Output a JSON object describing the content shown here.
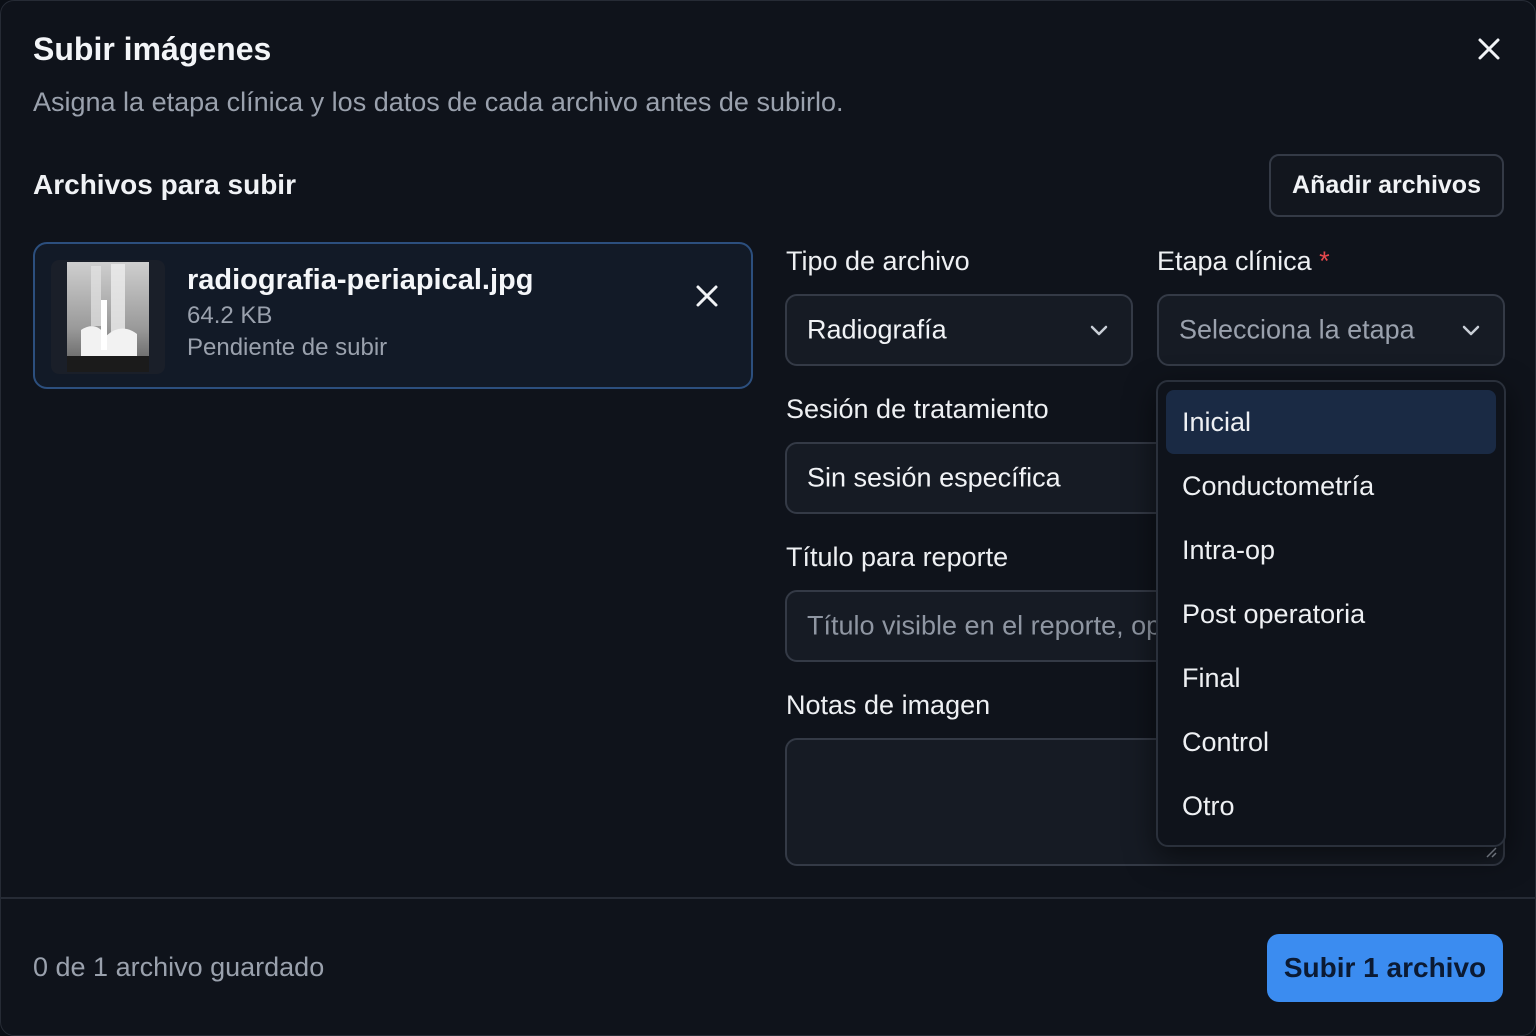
{
  "dialog": {
    "title": "Subir imágenes",
    "subtitle": "Asigna la etapa clínica y los datos de cada archivo antes de subirlo.",
    "close_icon": "close-icon"
  },
  "files_section": {
    "title": "Archivos para subir",
    "add_label": "Añadir archivos"
  },
  "file": {
    "name": "radiografia-periapical.jpg",
    "size": "64.2 KB",
    "status": "Pendiente de subir",
    "remove_icon": "close-icon"
  },
  "form": {
    "file_type": {
      "label": "Tipo de archivo",
      "value": "Radiografía"
    },
    "stage": {
      "label": "Etapa clínica",
      "required_mark": "*",
      "placeholder": "Selecciona la etapa"
    },
    "session": {
      "label": "Sesión de tratamiento",
      "value": "Sin sesión específica"
    },
    "report_title": {
      "label": "Título para reporte",
      "placeholder": "Título visible en el reporte, opcional"
    },
    "notes": {
      "label": "Notas de imagen",
      "value": ""
    }
  },
  "stage_options": {
    "items": [
      "Inicial",
      "Conductometría",
      "Intra-op",
      "Post operatoria",
      "Final",
      "Control",
      "Otro"
    ],
    "highlighted": "Inicial"
  },
  "footer": {
    "saved_text": "0 de 1 archivo guardado",
    "submit_label": "Subir 1 archivo"
  },
  "colors": {
    "accent": "#3b8cf0",
    "card_border": "#2c4f7e",
    "required": "#e5484d"
  }
}
